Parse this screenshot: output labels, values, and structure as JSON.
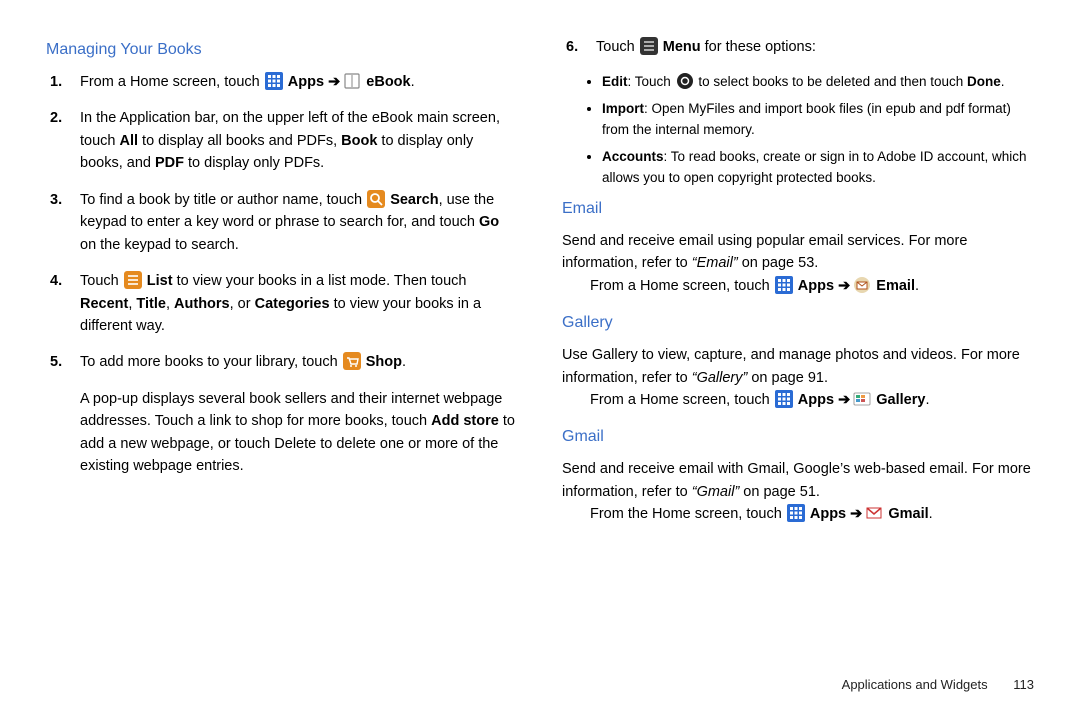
{
  "left": {
    "heading": "Managing Your Books",
    "items": [
      {
        "num": "1.",
        "pre": "From a Home screen, touch ",
        "apps": "Apps",
        "arrow": " ➔ ",
        "target": "eBook",
        "post": "."
      },
      {
        "num": "2.",
        "text_a": "In the Application bar, on the upper left of the eBook main screen, touch ",
        "b1": "All",
        "text_b": " to display all books and PDFs, ",
        "b2": "Book",
        "text_c": " to display only books, and ",
        "b3": "PDF",
        "text_d": " to display only PDFs."
      },
      {
        "num": "3.",
        "text_a": "To find a book by title or author name, touch ",
        "b1": "Search",
        "text_b": ", use the keypad to enter a key word or phrase to search for, and touch ",
        "b2": "Go",
        "text_c": " on the keypad to search."
      },
      {
        "num": "4.",
        "text_a": "Touch ",
        "b1": "List",
        "text_b": " to view your books in a list mode. Then touch ",
        "b2": "Recent",
        "sep1": ", ",
        "b3": "Title",
        "sep2": ", ",
        "b4": "Authors",
        "sep3": ", or ",
        "b5": "Categories",
        "text_c": " to view your books in a different way."
      },
      {
        "num": "5.",
        "text_a": "To add more books to your library, touch ",
        "b1": "Shop",
        "post": "."
      },
      {
        "num": "",
        "text_a": "A pop-up displays several book sellers and their internet webpage addresses. Touch a link to shop for more books, touch ",
        "b1": "Add store",
        "text_b": " to add a new webpage, or touch Delete to delete one or more of the existing webpage entries."
      }
    ]
  },
  "right": {
    "step6": {
      "num": "6.",
      "text_a": "Touch ",
      "b1": "Menu",
      "text_b": " for these options:"
    },
    "bullets": [
      {
        "b": "Edit",
        "text_a": ": Touch ",
        "text_b": " to select books to be deleted and then touch ",
        "b2": "Done",
        "post": "."
      },
      {
        "b": "Import",
        "text": ": Open MyFiles and import book files (in epub and pdf format) from the internal memory."
      },
      {
        "b": "Accounts",
        "text": ": To read books, create or sign in to Adobe ID account, which allows you to open copyright protected books."
      }
    ],
    "email": {
      "heading": "Email",
      "body_a": "Send and receive email using popular email services. For more information, refer to ",
      "ref": "“Email”",
      "body_b": " on page 53.",
      "line_a": "From a Home screen, touch ",
      "apps": "Apps",
      "arrow": " ➔ ",
      "target": "Email",
      "post": "."
    },
    "gallery": {
      "heading": "Gallery",
      "body_a": "Use Gallery to view, capture, and manage photos and videos. For more information, refer to ",
      "ref": "“Gallery”",
      "body_b": " on page 91.",
      "line_a": "From a Home screen, touch ",
      "apps": "Apps",
      "arrow": " ➔ ",
      "target": "Gallery",
      "post": "."
    },
    "gmail": {
      "heading": "Gmail",
      "body_a": "Send and receive email with Gmail, Google’s web-based email. For more information, refer to ",
      "ref": "“Gmail”",
      "body_b": " on page 51.",
      "line_a": "From the Home screen, touch ",
      "apps": "Apps",
      "arrow": " ➔ ",
      "target": "Gmail",
      "post": "."
    }
  },
  "footer": {
    "section": "Applications and Widgets",
    "page": "113"
  }
}
